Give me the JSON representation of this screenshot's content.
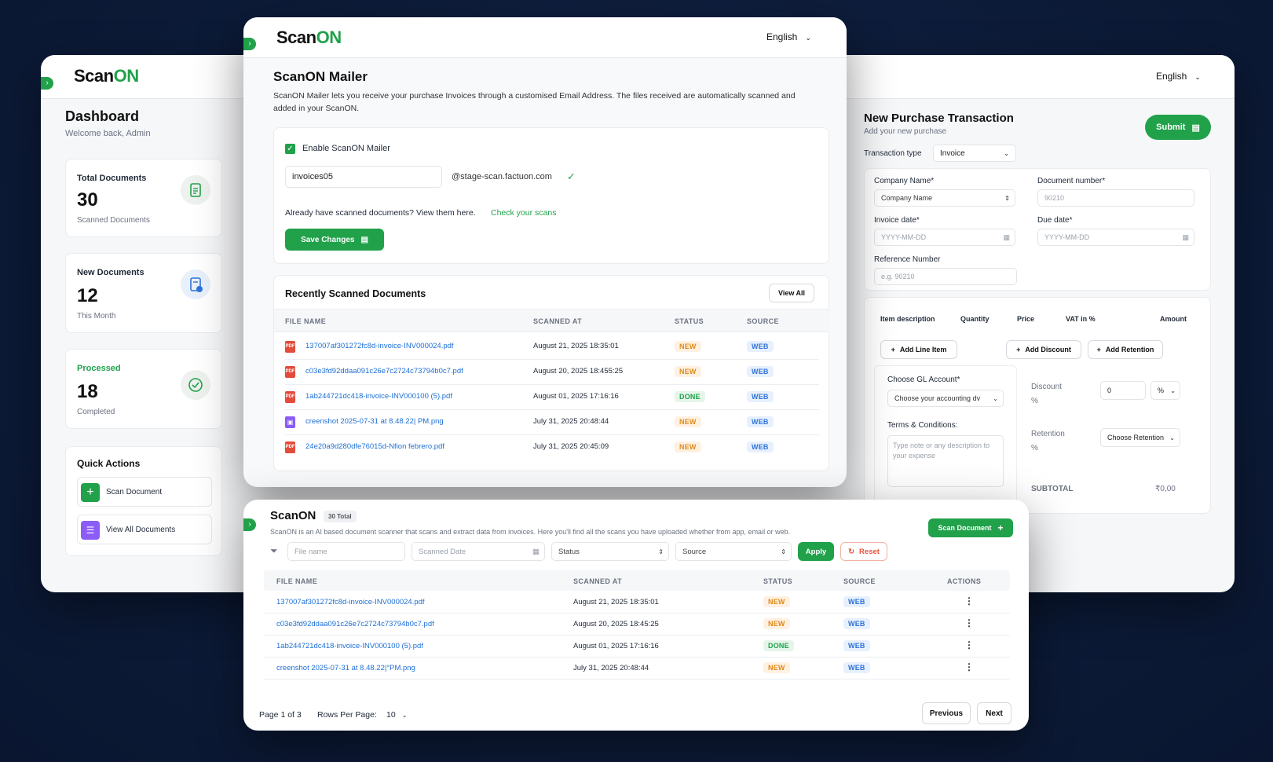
{
  "brand": {
    "logo_prefix": "Scan",
    "logo_suffix": "ON",
    "accent": "#21a14a"
  },
  "language": "English",
  "dashboard": {
    "title": "Dashboard",
    "welcome": "Welcome back, Admin",
    "stats": [
      {
        "label": "Total Documents",
        "value": "30",
        "sub": "Scanned Documents",
        "icon": "document-icon"
      },
      {
        "label": "New Documents",
        "value": "12",
        "sub": "This Month",
        "icon": "document-add-icon"
      },
      {
        "label": "Processed",
        "value": "18",
        "sub": "Completed",
        "icon": "check-circle-icon"
      }
    ],
    "quick_actions": {
      "title": "Quick Actions",
      "items": [
        "Scan Document",
        "View All Documents"
      ]
    }
  },
  "mailer": {
    "title": "ScanON Mailer",
    "description": "ScanON Mailer lets you receive your purchase Invoices through a customised Email Address. The files received are automatically scanned and added in your ScanON.",
    "enable_label": "Enable ScanON Mailer",
    "email_prefix": "invoices05",
    "email_domain": "@stage-scan.factuon.com",
    "already_text": "Already have scanned documents? View them here.",
    "check_link": "Check your scans",
    "save_button": "Save Changes",
    "recent": {
      "title": "Recently Scanned Documents",
      "view_all": "View All",
      "columns": [
        "FILE NAME",
        "SCANNED AT",
        "STATUS",
        "SOURCE"
      ],
      "rows": [
        {
          "file": "137007af301272fc8d-invoice-INV000024.pdf",
          "at": "August 21, 2025 18:35:01",
          "status": "NEW",
          "source": "WEB",
          "type": "pdf"
        },
        {
          "file": "c03e3fd92ddaa091c26e7c2724c73794b0c7.pdf",
          "at": "August 20, 2025 18:455:25",
          "status": "NEW",
          "source": "WEB",
          "type": "pdf"
        },
        {
          "file": "1ab244721dc418-invoice-INV000100 (5).pdf",
          "at": "August 01, 2025 17:16:16",
          "status": "DONE",
          "source": "WEB",
          "type": "pdf"
        },
        {
          "file": "creenshot 2025-07-31 at 8.48.22| PM.png",
          "at": "July 31, 2025 20:48:44",
          "status": "NEW",
          "source": "WEB",
          "type": "img"
        },
        {
          "file": "24e20a9d280dfe76015d-Nfion febrero.pdf",
          "at": "July 31, 2025 20:45:09",
          "status": "NEW",
          "source": "WEB",
          "type": "pdf"
        }
      ]
    }
  },
  "purchase": {
    "title": "New Purchase Transaction",
    "subtitle": "Add your new purchase",
    "submit": "Submit",
    "transaction_type_label": "Transaction type",
    "transaction_type_value": "Invoice",
    "company_label": "Company Name*",
    "company_placeholder": "Company Name",
    "docnum_label": "Document number*",
    "docnum_placeholder": "90210",
    "invoice_date_label": "Invoice date*",
    "invoice_date_placeholder": "YYYY-MM-DD",
    "due_date_label": "Due date*",
    "due_date_placeholder": "YYYY-MM-DD",
    "reference_label": "Reference Number",
    "reference_placeholder": "e.g. 90210",
    "item_columns": [
      "Item description",
      "Quantity",
      "Price",
      "VAT in %",
      "Amount"
    ],
    "add_line": "Add Line Item",
    "add_discount": "Add Discount",
    "add_retention": "Add Retention",
    "gl_label": "Choose GL Account*",
    "gl_placeholder": "Choose your accounting dv",
    "terms_label": "Terms & Conditions:",
    "terms_placeholder": "Type note or any description to your expense",
    "discount_label": "Discount",
    "discount_unit": "%",
    "discount_value": "0",
    "discount_select": "%",
    "retention_label": "Retention",
    "retention_unit": "%",
    "retention_select": "Choose Retention",
    "subtotal_label": "SUBTOTAL",
    "subtotal_value": "₹0,00"
  },
  "scanlist": {
    "title": "ScanON",
    "total_badge": "30 Total",
    "description": "ScanON is an AI based document scanner that scans and extract data from invoices. Here you'll find all the scans you have uploaded whether from app, email or web.",
    "scan_button": "Scan Document",
    "filters": {
      "file_name": "File name",
      "scanned_date": "Scanned Date",
      "status": "Status",
      "source": "Source",
      "apply": "Apply",
      "reset": "Reset"
    },
    "columns": [
      "FILE NAME",
      "SCANNED AT",
      "STATUS",
      "SOURCE",
      "ACTIONS"
    ],
    "rows": [
      {
        "file": "137007af301272fc8d-invoice-INV000024.pdf",
        "at": "August 21, 2025 18:35:01",
        "status": "NEW",
        "source": "WEB"
      },
      {
        "file": "c03e3fd92ddaa091c26e7c2724c73794b0c7.pdf",
        "at": "August 20, 2025 18:45:25",
        "status": "NEW",
        "source": "WEB"
      },
      {
        "file": "1ab244721dc418-invoice-INV000100 (5).pdf",
        "at": "August 01, 2025 17:16:16",
        "status": "DONE",
        "source": "WEB"
      },
      {
        "file": "creenshot 2025-07-31 at 8.48.22|°PM.png",
        "at": "July 31, 2025 20:48:44",
        "status": "NEW",
        "source": "WEB"
      }
    ],
    "pagination": {
      "page_text": "Page 1 of 3",
      "rows_label": "Rows Per Page:",
      "rows_value": "10",
      "previous": "Previous",
      "next": "Next"
    }
  }
}
